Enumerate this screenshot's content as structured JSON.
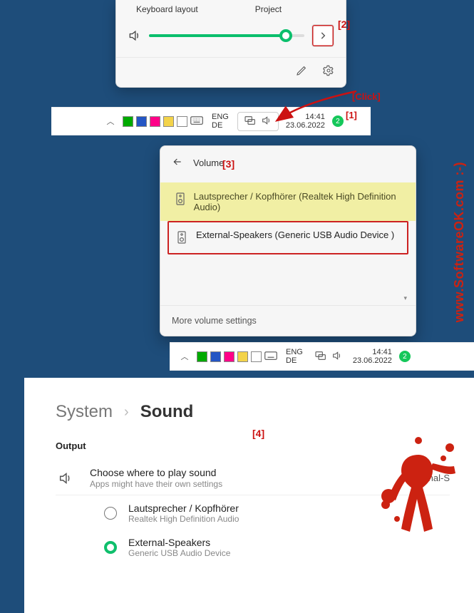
{
  "quick_settings": {
    "labels": {
      "keyboard": "Keyboard layout",
      "project": "Project"
    },
    "slider": {
      "aria": "Volume",
      "percent": 88
    },
    "next_aria": "Manage audio devices",
    "edit_aria": "Edit quick settings",
    "gear_aria": "Settings"
  },
  "taskbar": {
    "overflow_aria": "Show hidden icons",
    "lang_top": "ENG",
    "lang_bottom": "DE",
    "net_aria": "Network",
    "vol_aria": "Volume",
    "time": "14:41",
    "date": "23.06.2022",
    "badge": "2"
  },
  "volume_popup": {
    "back_aria": "Back",
    "title": "Volume",
    "devices": [
      {
        "name": "Lautsprecher / Kopfhörer (Realtek High Definition Audio)"
      },
      {
        "name": "External-Speakers (Generic USB Audio Device   )"
      }
    ],
    "more": "More volume settings"
  },
  "settings": {
    "crumb_system": "System",
    "crumb_sound": "Sound",
    "section_output": "Output",
    "choose_title": "Choose where to play sound",
    "choose_sub": "Apps might have their own settings",
    "choose_value": "External-S",
    "radios": [
      {
        "title": "Lautsprecher / Kopfhörer",
        "sub": "Realtek High Definition Audio",
        "selected": false
      },
      {
        "title": "External-Speakers",
        "sub": "Generic USB Audio Device",
        "selected": true
      }
    ]
  },
  "annotations": {
    "a1": "[1]",
    "a2": "[2]",
    "a3": "[3]",
    "a4": "[4]",
    "click": "[Click]"
  },
  "watermark": "www.SoftwareOK.com :-)"
}
